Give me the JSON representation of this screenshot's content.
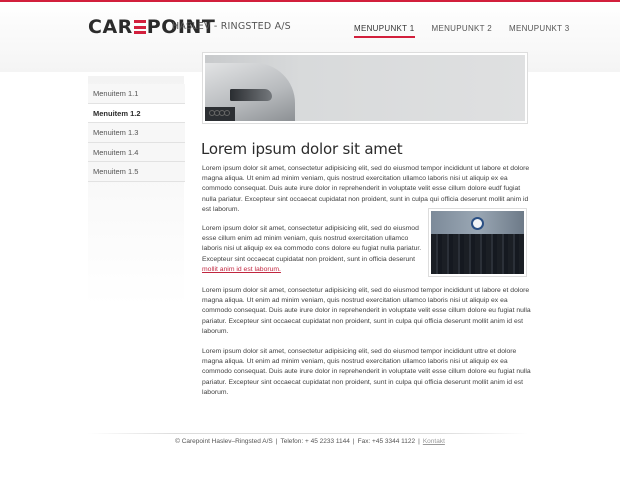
{
  "header": {
    "logo_text": "CAREPOINT",
    "tagline": "HASLEV - RINGSTED A/S",
    "nav": [
      "MENUPUNKT 1",
      "MENUPUNKT 2",
      "MENUPUNKT 3"
    ],
    "active_nav_index": 0,
    "accent_color": "#d21f3c"
  },
  "sidebar": {
    "items": [
      "Menuitem 1.1",
      "Menuitem 1.2",
      "Menuitem 1.3",
      "Menuitem 1.4",
      "Menuitem 1.5"
    ],
    "active_index": 1
  },
  "main": {
    "title": "Lorem ipsum dolor sit amet",
    "paragraphs": [
      "Lorem ipsum dolor sit amet, consectetur adipisicing elit, sed do eiusmod tempor incididunt ut labore et dolore magna aliqua. Ut enim ad minim veniam, quis nostrud exercitation ullamco laboris nisi ut aliquip ex ea commodo consequat. Duis aute irure dolor in reprehenderit in voluptate velit esse cillum dolore eudf fugiat nulla pariatur. Excepteur sint occaecat cupidatat non proident, sunt in culpa qui officia deserunt mollit anim id est laborum.",
      "Lorem ipsum dolor sit amet, consectetur adipisicing elit, sed do eiusmod esse cillum enim ad minim veniam, quis nostrud exercitation ullamco laboris nisi ut aliquip ex ea commodo cons dolore eu fugiat nulla pariatur. Excepteur sint occaecat cupidatat non proident, sunt in officia deserunt",
      "Lorem ipsum dolor sit amet, consectetur adipisicing elit, sed do eiusmod tempor incididunt ut labore et dolore magna aliqua. Ut enim ad minim veniam, quis nostrud exercitation ullamco laboris nisi ut aliquip ex ea commodo consequat. Duis aute irure dolor in reprehenderit in voluptate velit esse cillum dolore eu fugiat nulla pariatur. Excepteur sint occaecat cupidatat non proident, sunt in culpa qui officia deserunt mollit anim id est laborum.",
      "Lorem ipsum dolor sit amet, consectetur adipisicing elit, sed do eiusmod tempor incididunt uttre et dolore magna aliqua. Ut enim ad minim veniam, quis nostrud exercitation ullamco laboris nisi ut aliquip ex ea commodo consequat. Duis aute irure dolor in reprehenderit in voluptate velit esse cillum dolore eu fugiat nulla pariatur. Excepteur sint occaecat cupidatat non proident, sunt in culpa qui officia deserunt mollit anim id est laborum."
    ],
    "inline_link": "mollit anim id est laborum."
  },
  "footer": {
    "company": "© Carepoint Haslev–Ringsted A/S",
    "phone": "Telefon: + 45 2233 1144",
    "fax": "Fax: +45 3344 1122",
    "contact_link": "Kontakt"
  }
}
